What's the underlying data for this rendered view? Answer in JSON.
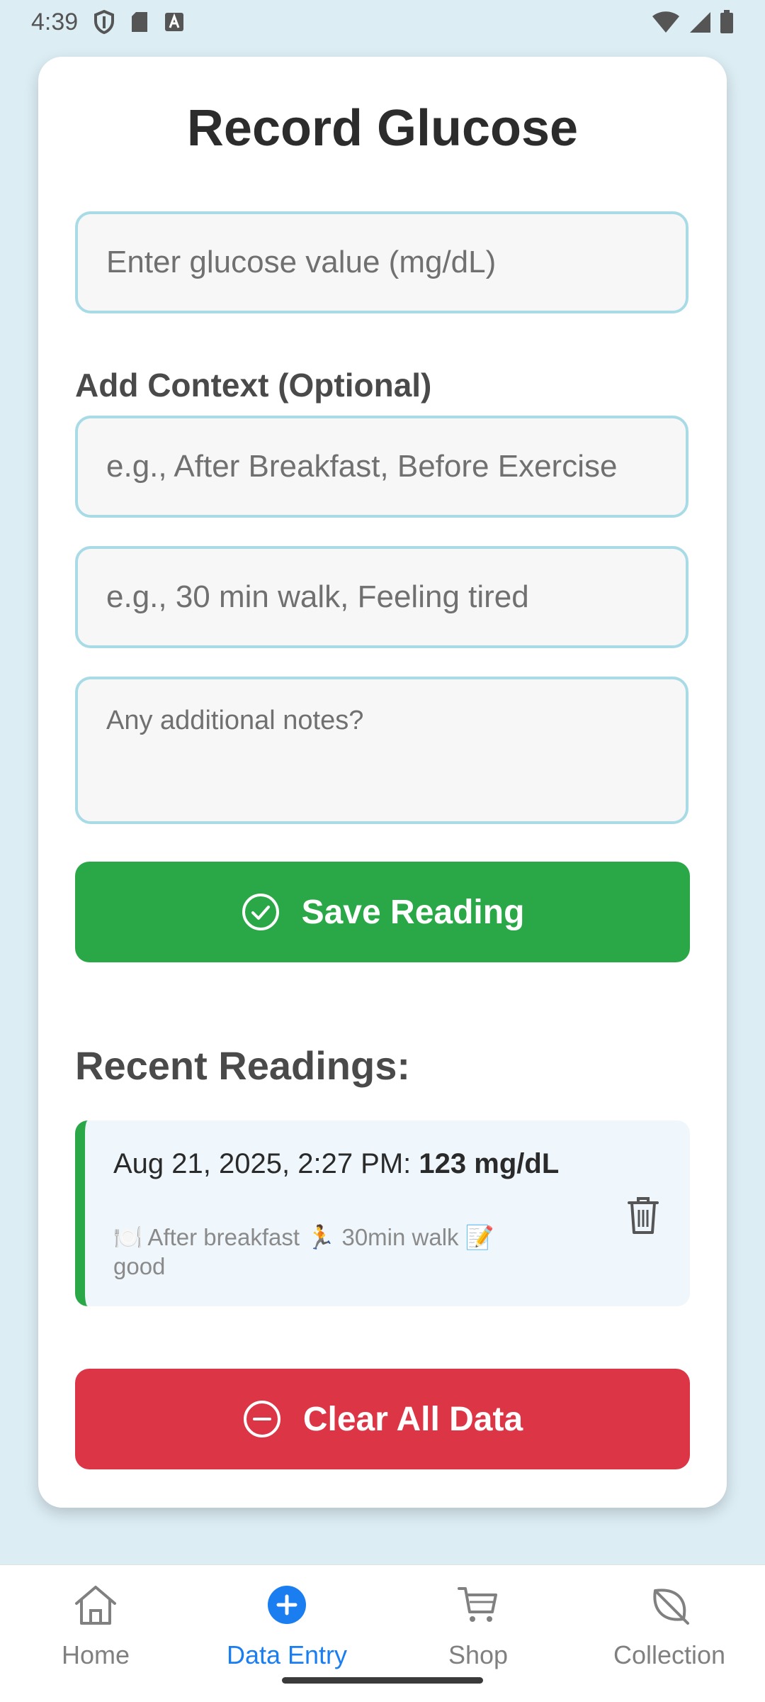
{
  "status_bar": {
    "time": "4:39"
  },
  "form": {
    "title": "Record Glucose",
    "glucose_placeholder": "Enter glucose value (mg/dL)",
    "context_label": "Add Context (Optional)",
    "meal_placeholder": "e.g., After Breakfast, Before Exercise",
    "activity_placeholder": "e.g., 30 min walk, Feeling tired",
    "notes_placeholder": "Any additional notes?",
    "save_label": "Save Reading"
  },
  "recent": {
    "title": "Recent Readings:",
    "items": [
      {
        "timestamp": "Aug 21, 2025, 2:27 PM:",
        "value": "123 mg/dL",
        "meal": "🍽️ After breakfast",
        "activity": "🏃 30min walk",
        "notes": "📝 good"
      }
    ]
  },
  "clear_label": "Clear All Data",
  "colors": {
    "save": "#2aa847",
    "clear": "#dc3545",
    "accent": "#1a7ef0",
    "field_border": "#a9dbe6"
  },
  "nav": {
    "items": [
      {
        "label": "Home",
        "icon": "home-icon"
      },
      {
        "label": "Data Entry",
        "icon": "plus-circle-icon",
        "active": true
      },
      {
        "label": "Shop",
        "icon": "cart-icon"
      },
      {
        "label": "Collection",
        "icon": "leaf-icon"
      }
    ]
  }
}
